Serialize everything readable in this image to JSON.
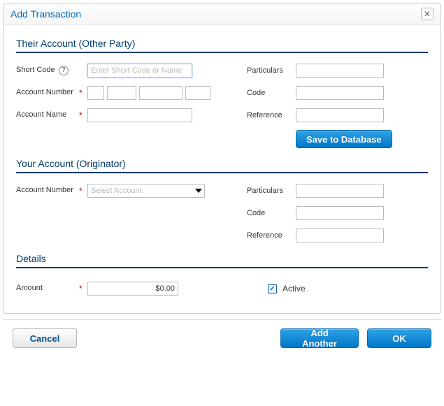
{
  "dialog": {
    "title": "Add Transaction"
  },
  "their": {
    "heading": "Their Account (Other Party)",
    "short_code_label": "Short Code",
    "short_code_placeholder": "Enter Short Code or Name",
    "short_code_value": "",
    "account_number_label": "Account Number",
    "acct1": "",
    "acct2": "",
    "acct3": "",
    "acct4": "",
    "account_name_label": "Account Name",
    "account_name_value": "",
    "particulars_label": "Particulars",
    "particulars_value": "",
    "code_label": "Code",
    "code_value": "",
    "reference_label": "Reference",
    "reference_value": "",
    "save_button": "Save to Database"
  },
  "your": {
    "heading": "Your Account (Originator)",
    "account_number_label": "Account Number",
    "account_placeholder": "Select Account",
    "particulars_label": "Particulars",
    "particulars_value": "",
    "code_label": "Code",
    "code_value": "",
    "reference_label": "Reference",
    "reference_value": ""
  },
  "details": {
    "heading": "Details",
    "amount_label": "Amount",
    "amount_value": "$0.00",
    "active_label": "Active",
    "active_checked": true
  },
  "footer": {
    "cancel": "Cancel",
    "add_another": "Add Another",
    "ok": "OK"
  }
}
